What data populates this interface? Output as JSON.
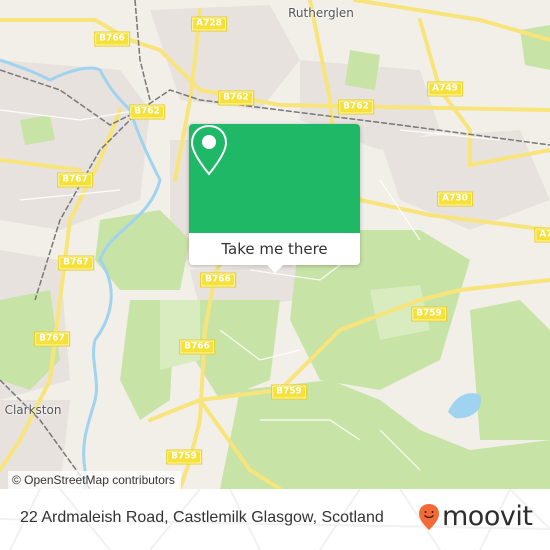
{
  "map": {
    "colors": {
      "background": "#f2efe9",
      "park": "#c8e3a6",
      "park_light": "#d8ecc0",
      "residential": "#e8e2de",
      "water": "#9fd3ef",
      "road_major": "#f7e47a",
      "road_minor": "#ffffff",
      "rail": "#777777"
    },
    "road_labels": [
      {
        "text": "B766"
      },
      {
        "text": "A728"
      },
      {
        "text": "B762"
      },
      {
        "text": "B762"
      },
      {
        "text": "B762"
      },
      {
        "text": "A749"
      },
      {
        "text": "B767"
      },
      {
        "text": "A730"
      },
      {
        "text": "B767"
      },
      {
        "text": "B767"
      },
      {
        "text": "B766"
      },
      {
        "text": "B766"
      },
      {
        "text": "B759"
      },
      {
        "text": "B759"
      },
      {
        "text": "B759"
      },
      {
        "text": "A7"
      }
    ],
    "place_labels": [
      {
        "text": "Rutherglen"
      },
      {
        "text": "Clarkston"
      }
    ],
    "attribution": "© OpenStreetMap contributors"
  },
  "popup": {
    "icon": "map-pin-icon",
    "button_label": "Take me there",
    "color": "#1eb866"
  },
  "footer": {
    "address": "22 Ardmaleish Road, Castlemilk Glasgow, Scotland",
    "brand": "moovit",
    "brand_icon": "moovit-smiley-pin-icon",
    "brand_color": "#f26a36"
  }
}
